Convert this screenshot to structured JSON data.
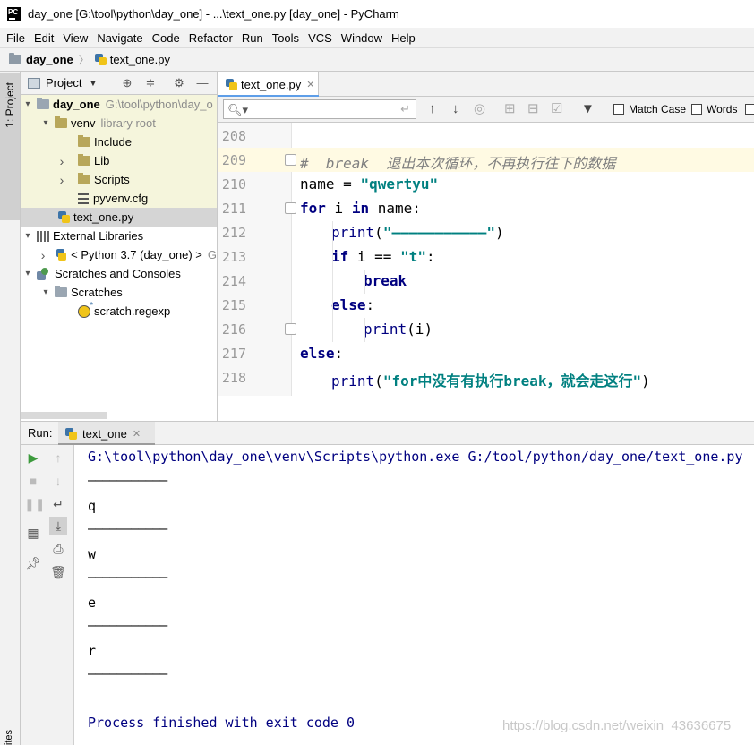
{
  "window": {
    "title": "day_one [G:\\tool\\python\\day_one] - ...\\text_one.py [day_one] - PyCharm",
    "logo_text": "PC"
  },
  "menu": [
    "File",
    "Edit",
    "View",
    "Navigate",
    "Code",
    "Refactor",
    "Run",
    "Tools",
    "VCS",
    "Window",
    "Help"
  ],
  "navbar": {
    "project": "day_one",
    "file": "text_one.py"
  },
  "left_strip": {
    "project_tab": "1: Project",
    "bottom_tab": "ites"
  },
  "project_panel": {
    "title": "Project",
    "tree": [
      {
        "label": "day_one",
        "extra": "G:\\tool\\python\\day_o",
        "arrow": "▾",
        "level": 0,
        "icon": "folder-icon"
      },
      {
        "label": "venv",
        "extra": "library root",
        "arrow": "▾",
        "level": 1,
        "icon": "folder-icon"
      },
      {
        "label": "Include",
        "arrow": "",
        "level": 2,
        "icon": "folder-icon"
      },
      {
        "label": "Lib",
        "arrow": "›",
        "level": 2,
        "icon": "folder-icon"
      },
      {
        "label": "Scripts",
        "arrow": "›",
        "level": 2,
        "icon": "folder-icon"
      },
      {
        "label": "pyvenv.cfg",
        "arrow": "",
        "level": 2,
        "icon": "config-file-icon"
      },
      {
        "label": "text_one.py",
        "arrow": "",
        "level": 1,
        "icon": "python-file-icon"
      },
      {
        "label": "External Libraries",
        "arrow": "▾",
        "level": 0,
        "icon": "library-icon"
      },
      {
        "label": "< Python 3.7 (day_one) >",
        "extra": "G",
        "arrow": "›",
        "level": 1,
        "icon": "python-sdk-icon"
      },
      {
        "label": "Scratches and Consoles",
        "arrow": "▾",
        "level": 0,
        "icon": "scratches-icon"
      },
      {
        "label": "Scratches",
        "arrow": "▾",
        "level": 1,
        "icon": "folder-icon"
      },
      {
        "label": "scratch.regexp",
        "arrow": "",
        "level": 2,
        "icon": "regexp-file-icon"
      }
    ]
  },
  "editor": {
    "tab": "text_one.py",
    "search": {
      "match_case": "Match Case",
      "words": "Words"
    },
    "line_numbers": [
      "208",
      "209",
      "210",
      "211",
      "212",
      "213",
      "214",
      "215",
      "216",
      "217",
      "218"
    ],
    "code": {
      "l209_comment": "#  break  退出本次循环，不再执行往下的数据",
      "l210_var": "name = ",
      "l210_str": "\"qwertyu\"",
      "l211_for": "for",
      "l211_i": " i ",
      "l211_in": "in",
      "l211_rest": " name:",
      "l212_print": "print",
      "l212_open": "(",
      "l212_str": "\"———————————\"",
      "l212_close": ")",
      "l213_if": "if",
      "l213_rest": " i == ",
      "l213_str": "\"t\"",
      "l213_colon": ":",
      "l214_break": "break",
      "l215_else": "else",
      "l215_colon": ":",
      "l216_print": "print",
      "l216_arg": "(i)",
      "l217_else": "else",
      "l217_colon": ":",
      "l218_print": "print",
      "l218_open": "(",
      "l218_str": "\"for中没有有执行break，就会走这行\"",
      "l218_close": ")"
    }
  },
  "run_panel": {
    "label": "Run:",
    "tab": "text_one",
    "console": [
      "G:\\tool\\python\\day_one\\venv\\Scripts\\python.exe G:/tool/python/day_one/text_one.py",
      "———————————",
      "q",
      "———————————",
      "w",
      "———————————",
      "e",
      "———————————",
      "r",
      "———————————",
      "Process finished with exit code 0"
    ],
    "watermark": "https://blog.csdn.net/weixin_43636675"
  }
}
